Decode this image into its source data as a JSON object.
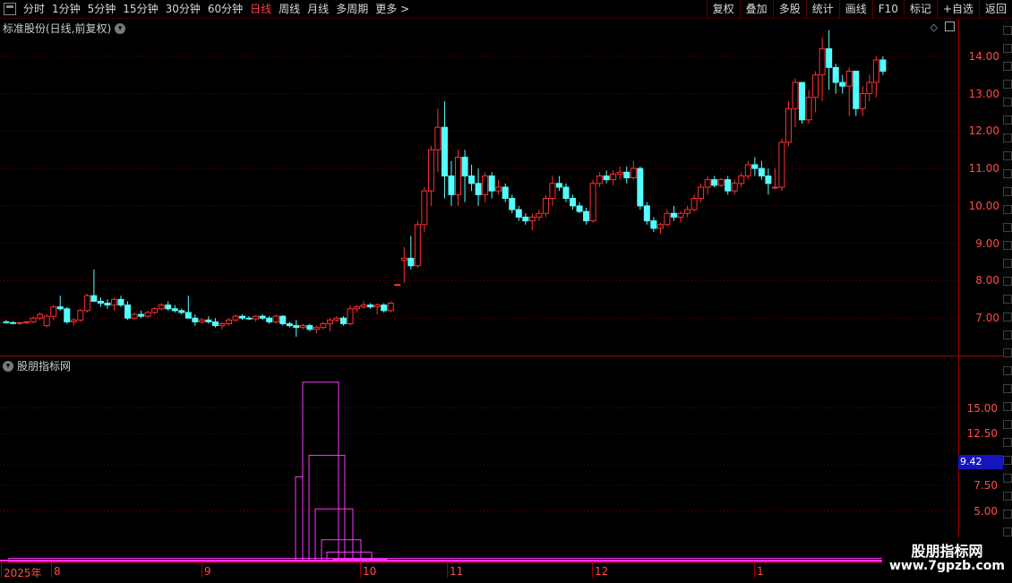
{
  "toolbar": {
    "left": [
      "分时",
      "1分钟",
      "5分钟",
      "15分钟",
      "30分钟",
      "60分钟",
      "日线",
      "周线",
      "月线",
      "多周期",
      "更多 >"
    ],
    "active_index": 6,
    "right": [
      "复权",
      "叠加",
      "多股",
      "统计",
      "画线",
      "F10",
      "标记",
      "+自选",
      "返回"
    ]
  },
  "main_panel": {
    "title": "标准股份(日线,前复权)"
  },
  "sub_panel": {
    "title": "股朋指标网"
  },
  "current_value": "9.42",
  "watermark": {
    "title": "股朋指标网",
    "url": "www.7gpzb.com"
  },
  "x_axis": [
    "2025年",
    "8",
    "9",
    "10",
    "11",
    "12",
    "1"
  ],
  "colors": {
    "up": "#ff3030",
    "down": "#54ffff",
    "grid": "#7a0000",
    "axis": "#ff4c4c",
    "indicator": "#ff33ff"
  },
  "chart_data": [
    {
      "type": "candlestick",
      "title": "标准股份(日线,前复权)",
      "ylim": [
        6.0,
        15.0
      ],
      "y_ticks": [
        "7.00",
        "8.00",
        "9.00",
        "10.00",
        "11.00",
        "12.00",
        "13.00",
        "14.00"
      ],
      "series": [
        {
          "ohlc": [
            [
              6.9,
              6.95,
              6.85,
              6.88
            ],
            [
              6.88,
              6.92,
              6.83,
              6.86
            ],
            [
              6.86,
              6.9,
              6.82,
              6.88
            ],
            [
              6.88,
              6.92,
              6.84,
              6.9
            ],
            [
              6.9,
              7.05,
              6.85,
              7.0
            ],
            [
              7.0,
              7.15,
              6.95,
              7.1
            ],
            [
              6.8,
              7.1,
              6.75,
              7.05
            ],
            [
              7.05,
              7.35,
              6.95,
              7.3
            ],
            [
              7.3,
              7.6,
              7.2,
              7.25
            ],
            [
              7.25,
              7.3,
              6.85,
              6.9
            ],
            [
              6.9,
              7.0,
              6.8,
              6.95
            ],
            [
              6.95,
              7.25,
              6.9,
              7.2
            ],
            [
              7.2,
              7.65,
              7.15,
              7.6
            ],
            [
              7.6,
              8.3,
              7.5,
              7.45
            ],
            [
              7.45,
              7.55,
              7.3,
              7.4
            ],
            [
              7.4,
              7.5,
              7.25,
              7.35
            ],
            [
              7.35,
              7.55,
              7.2,
              7.5
            ],
            [
              7.5,
              7.6,
              7.3,
              7.35
            ],
            [
              7.35,
              7.45,
              6.95,
              7.0
            ],
            [
              7.0,
              7.15,
              6.95,
              7.1
            ],
            [
              7.1,
              7.2,
              7.0,
              7.05
            ],
            [
              7.05,
              7.2,
              7.0,
              7.15
            ],
            [
              7.15,
              7.3,
              7.1,
              7.25
            ],
            [
              7.25,
              7.4,
              7.2,
              7.35
            ],
            [
              7.35,
              7.45,
              7.2,
              7.25
            ],
            [
              7.25,
              7.35,
              7.15,
              7.2
            ],
            [
              7.2,
              7.25,
              7.1,
              7.15
            ],
            [
              7.15,
              7.6,
              7.1,
              7.0
            ],
            [
              7.0,
              7.1,
              6.8,
              6.9
            ],
            [
              6.9,
              7.0,
              6.85,
              6.95
            ],
            [
              6.95,
              7.05,
              6.85,
              6.9
            ],
            [
              6.9,
              7.0,
              6.75,
              6.8
            ],
            [
              6.8,
              6.9,
              6.7,
              6.85
            ],
            [
              6.85,
              7.0,
              6.8,
              6.95
            ],
            [
              6.95,
              7.1,
              6.9,
              7.05
            ],
            [
              7.05,
              7.1,
              6.95,
              7.0
            ],
            [
              7.0,
              7.05,
              6.95,
              6.98
            ],
            [
              6.98,
              7.08,
              6.9,
              7.05
            ],
            [
              7.05,
              7.1,
              6.95,
              7.0
            ],
            [
              7.0,
              7.05,
              6.85,
              6.9
            ],
            [
              6.9,
              7.1,
              6.85,
              7.05
            ],
            [
              7.05,
              7.08,
              6.8,
              6.85
            ],
            [
              6.85,
              6.9,
              6.75,
              6.8
            ],
            [
              6.8,
              6.95,
              6.5,
              6.75
            ],
            [
              6.75,
              6.85,
              6.7,
              6.8
            ],
            [
              6.8,
              6.85,
              6.65,
              6.7
            ],
            [
              6.7,
              6.8,
              6.6,
              6.75
            ],
            [
              6.75,
              6.9,
              6.7,
              6.85
            ],
            [
              6.85,
              7.0,
              6.65,
              6.95
            ],
            [
              6.95,
              7.05,
              6.9,
              7.0
            ],
            [
              7.0,
              7.05,
              6.8,
              6.85
            ],
            [
              6.85,
              7.35,
              6.8,
              7.25
            ],
            [
              7.25,
              7.35,
              7.15,
              7.3
            ],
            [
              7.3,
              7.45,
              7.25,
              7.35
            ],
            [
              7.35,
              7.4,
              7.25,
              7.3
            ],
            [
              7.3,
              7.4,
              7.1,
              7.35
            ],
            [
              7.35,
              7.4,
              7.15,
              7.2
            ],
            [
              7.2,
              7.45,
              7.15,
              7.4
            ],
            [
              7.9,
              7.9,
              7.9,
              7.9
            ],
            [
              8.55,
              8.9,
              7.95,
              8.6
            ],
            [
              8.6,
              9.2,
              8.3,
              8.4
            ],
            [
              8.4,
              9.6,
              8.35,
              9.5
            ],
            [
              9.5,
              10.5,
              9.3,
              10.4
            ],
            [
              10.4,
              11.6,
              10.0,
              11.5
            ],
            [
              11.5,
              12.6,
              10.9,
              12.1
            ],
            [
              12.1,
              12.8,
              10.2,
              10.8
            ],
            [
              10.8,
              11.2,
              10.0,
              10.3
            ],
            [
              10.3,
              11.5,
              10.0,
              11.3
            ],
            [
              11.3,
              11.5,
              10.1,
              10.8
            ],
            [
              10.8,
              11.1,
              10.4,
              10.6
            ],
            [
              10.6,
              11.0,
              10.0,
              10.3
            ],
            [
              10.3,
              10.9,
              10.1,
              10.8
            ],
            [
              10.8,
              10.9,
              10.2,
              10.4
            ],
            [
              10.4,
              10.7,
              10.3,
              10.5
            ],
            [
              10.5,
              10.6,
              10.1,
              10.2
            ],
            [
              10.2,
              10.3,
              9.8,
              9.9
            ],
            [
              9.9,
              10.0,
              9.6,
              9.7
            ],
            [
              9.7,
              9.8,
              9.5,
              9.6
            ],
            [
              9.6,
              9.8,
              9.35,
              9.7
            ],
            [
              9.7,
              9.9,
              9.6,
              9.8
            ],
            [
              9.8,
              10.3,
              9.7,
              10.2
            ],
            [
              10.2,
              10.8,
              10.0,
              10.6
            ],
            [
              10.6,
              10.8,
              10.4,
              10.5
            ],
            [
              10.5,
              10.6,
              10.1,
              10.2
            ],
            [
              10.2,
              10.3,
              9.9,
              10.0
            ],
            [
              10.0,
              10.1,
              9.8,
              9.85
            ],
            [
              9.85,
              9.95,
              9.5,
              9.6
            ],
            [
              9.6,
              10.7,
              9.55,
              10.6
            ],
            [
              10.6,
              10.9,
              10.5,
              10.8
            ],
            [
              10.8,
              10.95,
              10.6,
              10.7
            ],
            [
              10.7,
              10.95,
              10.55,
              10.85
            ],
            [
              10.85,
              11.05,
              10.7,
              10.9
            ],
            [
              10.9,
              11.05,
              10.6,
              10.75
            ],
            [
              10.75,
              11.2,
              10.7,
              11.0
            ],
            [
              11.0,
              11.05,
              9.9,
              10.0
            ],
            [
              10.0,
              10.1,
              9.5,
              9.6
            ],
            [
              9.6,
              9.7,
              9.3,
              9.4
            ],
            [
              9.4,
              9.55,
              9.25,
              9.5
            ],
            [
              9.5,
              9.9,
              9.45,
              9.8
            ],
            [
              9.8,
              10.0,
              9.6,
              9.7
            ],
            [
              9.7,
              9.85,
              9.55,
              9.8
            ],
            [
              9.8,
              10.0,
              9.7,
              9.9
            ],
            [
              9.9,
              10.3,
              9.85,
              10.2
            ],
            [
              10.2,
              10.6,
              10.1,
              10.5
            ],
            [
              10.5,
              10.8,
              10.3,
              10.7
            ],
            [
              10.7,
              10.8,
              10.5,
              10.55
            ],
            [
              10.55,
              10.75,
              10.5,
              10.7
            ],
            [
              10.7,
              10.8,
              10.3,
              10.4
            ],
            [
              10.4,
              10.7,
              10.3,
              10.6
            ],
            [
              10.6,
              10.9,
              10.5,
              10.8
            ],
            [
              10.8,
              11.2,
              10.7,
              11.1
            ],
            [
              11.1,
              11.3,
              10.8,
              11.0
            ],
            [
              11.0,
              11.2,
              10.7,
              10.8
            ],
            [
              10.8,
              11.0,
              10.3,
              10.6
            ],
            [
              10.5,
              11.0,
              10.45,
              10.5
            ],
            [
              10.5,
              11.8,
              10.4,
              11.7
            ],
            [
              11.7,
              12.8,
              11.6,
              12.6
            ],
            [
              12.6,
              13.4,
              12.1,
              13.3
            ],
            [
              13.3,
              13.3,
              12.2,
              12.3
            ],
            [
              12.3,
              13.1,
              12.2,
              12.9
            ],
            [
              12.9,
              13.6,
              12.5,
              13.5
            ],
            [
              13.5,
              14.5,
              12.8,
              14.2
            ],
            [
              14.2,
              14.7,
              13.1,
              13.7
            ],
            [
              13.7,
              13.8,
              13.0,
              13.3
            ],
            [
              13.3,
              13.5,
              13.0,
              13.2
            ],
            [
              13.2,
              13.7,
              12.4,
              13.6
            ],
            [
              13.6,
              13.6,
              12.4,
              12.6
            ],
            [
              12.6,
              13.2,
              12.4,
              13.0
            ],
            [
              13.0,
              13.5,
              12.8,
              13.3
            ],
            [
              13.3,
              14.0,
              12.9,
              13.9
            ],
            [
              13.9,
              14.0,
              13.5,
              13.6
            ]
          ]
        }
      ]
    },
    {
      "type": "bar",
      "title": "股朋指标网",
      "ylim": [
        0,
        20.0
      ],
      "y_ticks": [
        "5.00",
        "7.50",
        "12.50",
        "15.00"
      ],
      "current": 9.42,
      "series": [
        {
          "values": [
            0.4,
            17.5,
            10.4,
            5.2,
            2.2,
            1.0,
            0.3,
            0.1,
            0.05
          ]
        }
      ]
    }
  ]
}
